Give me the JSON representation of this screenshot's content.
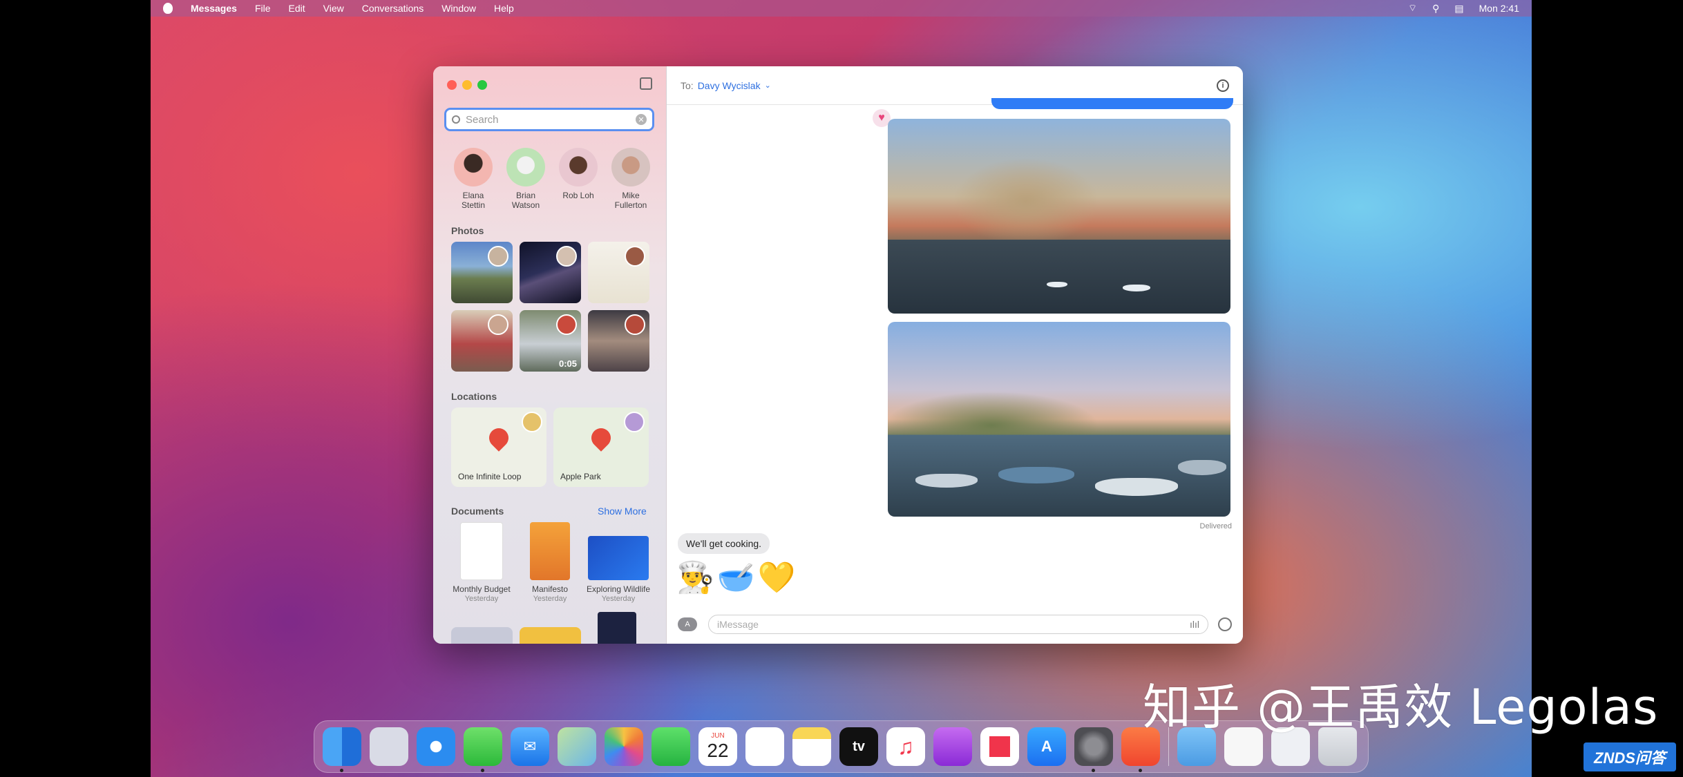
{
  "menubar": {
    "app": "Messages",
    "items": [
      "File",
      "Edit",
      "View",
      "Conversations",
      "Window",
      "Help"
    ],
    "clock": "Mon 2:41"
  },
  "sidebar": {
    "search_placeholder": "Search",
    "contacts": [
      {
        "name": "Elana\nStettin",
        "color": "#f3b6b0"
      },
      {
        "name": "Brian\nWatson",
        "color": "#bde3b5"
      },
      {
        "name": "Rob Loh",
        "color": "#e9c7d0"
      },
      {
        "name": "Mike\nFullerton",
        "color": "#d7c3c0"
      }
    ],
    "photos_title": "Photos",
    "video_duration": "0:05",
    "locations_title": "Locations",
    "locations": [
      "One Infinite Loop",
      "Apple Park"
    ],
    "documents_title": "Documents",
    "show_more": "Show More",
    "documents": [
      {
        "name": "Monthly Budget",
        "date": "Yesterday"
      },
      {
        "name": "Manifesto",
        "date": "Yesterday"
      },
      {
        "name": "Exploring Wildlife",
        "date": "Yesterday"
      }
    ]
  },
  "conversation": {
    "to_label": "To:",
    "recipient": "Davy Wycislak",
    "delivered": "Delivered",
    "received_message": "We'll get cooking.",
    "emojis": "👨‍🍳🥣💛",
    "input_placeholder": "iMessage"
  },
  "dock": {
    "calendar_month": "JUN",
    "calendar_day": "22",
    "tv_label": "tv"
  },
  "watermark": "知乎 @王禹效 Legolas",
  "znds_logo": "ZNDS问答"
}
